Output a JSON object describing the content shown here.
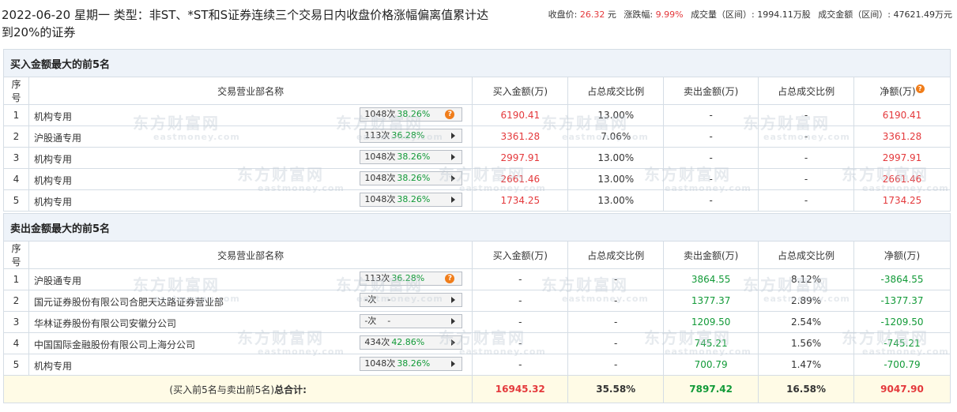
{
  "header": {
    "title": "2022-06-20 星期一 类型：非ST、*ST和S证券连续三个交易日内收盘价格涨幅偏离值累计达到20%的证券",
    "close_label": "收盘价:",
    "close_value": "26.32",
    "close_unit": "元",
    "change_label": "涨跌幅:",
    "change_value": "9.99%",
    "volume_label": "成交量（区间）:",
    "volume_value": "1994.11万股",
    "amount_label": "成交金额（区间）:",
    "amount_value": "47621.49万元"
  },
  "watermark": {
    "cn": "东方财富网",
    "en": "eastmoney.com"
  },
  "columns": {
    "seq": "序号",
    "name": "交易营业部名称",
    "buy": "买入金额(万)",
    "buy_ratio": "占总成交比例",
    "sell": "卖出金额(万)",
    "sell_ratio": "占总成交比例",
    "net": "净额(万)"
  },
  "buy_section": {
    "title": "买入金额最大的前5名",
    "rows": [
      {
        "seq": "1",
        "name": "机构专用",
        "count": "1048次",
        "pct": "38.26%",
        "icon": "help-icon",
        "buy": "6190.41",
        "buy_ratio": "13.00%",
        "sell": "-",
        "sell_ratio": "-",
        "net": "6190.41"
      },
      {
        "seq": "2",
        "name": "沪股通专用",
        "count": "113次",
        "pct": "36.28%",
        "icon": "arrow-right-icon",
        "buy": "3361.28",
        "buy_ratio": "7.06%",
        "sell": "-",
        "sell_ratio": "-",
        "net": "3361.28"
      },
      {
        "seq": "3",
        "name": "机构专用",
        "count": "1048次",
        "pct": "38.26%",
        "icon": "arrow-right-icon",
        "buy": "2997.91",
        "buy_ratio": "13.00%",
        "sell": "-",
        "sell_ratio": "-",
        "net": "2997.91"
      },
      {
        "seq": "4",
        "name": "机构专用",
        "count": "1048次",
        "pct": "38.26%",
        "icon": "arrow-right-icon",
        "buy": "2661.46",
        "buy_ratio": "13.00%",
        "sell": "-",
        "sell_ratio": "-",
        "net": "2661.46"
      },
      {
        "seq": "5",
        "name": "机构专用",
        "count": "1048次",
        "pct": "38.26%",
        "icon": "arrow-right-icon",
        "buy": "1734.25",
        "buy_ratio": "13.00%",
        "sell": "-",
        "sell_ratio": "-",
        "net": "1734.25"
      }
    ]
  },
  "sell_section": {
    "title": "卖出金额最大的前5名",
    "rows": [
      {
        "seq": "1",
        "name": "沪股通专用",
        "count": "113次",
        "pct": "36.28%",
        "icon": "help-icon",
        "buy": "-",
        "buy_ratio": "-",
        "sell": "3864.55",
        "sell_ratio": "8.12%",
        "net": "-3864.55"
      },
      {
        "seq": "2",
        "name": "国元证券股份有限公司合肥天达路证券营业部",
        "count": "-次",
        "pct": "-",
        "icon": "arrow-right-icon",
        "buy": "-",
        "buy_ratio": "-",
        "sell": "1377.37",
        "sell_ratio": "2.89%",
        "net": "-1377.37"
      },
      {
        "seq": "3",
        "name": "华林证券股份有限公司安徽分公司",
        "count": "-次",
        "pct": "-",
        "icon": "arrow-right-icon",
        "buy": "-",
        "buy_ratio": "-",
        "sell": "1209.50",
        "sell_ratio": "2.54%",
        "net": "-1209.50"
      },
      {
        "seq": "4",
        "name": "中国国际金融股份有限公司上海分公司",
        "count": "434次",
        "pct": "42.86%",
        "icon": "arrow-right-icon",
        "buy": "-",
        "buy_ratio": "-",
        "sell": "745.21",
        "sell_ratio": "1.56%",
        "net": "-745.21"
      },
      {
        "seq": "5",
        "name": "机构专用",
        "count": "1048次",
        "pct": "38.26%",
        "icon": "arrow-right-icon",
        "buy": "-",
        "buy_ratio": "-",
        "sell": "700.79",
        "sell_ratio": "1.47%",
        "net": "-700.79"
      }
    ]
  },
  "total": {
    "label_prefix": "(买入前5名与卖出前5名)",
    "label_main": "总合计:",
    "buy": "16945.32",
    "buy_ratio": "35.58%",
    "sell": "7897.42",
    "sell_ratio": "16.58%",
    "net": "9047.90"
  },
  "colors": {
    "up": "#e4393c",
    "down": "#129a38",
    "section_bg": "#eef3f9",
    "total_bg": "#fffbe6",
    "help_icon": "#f07d1a"
  }
}
